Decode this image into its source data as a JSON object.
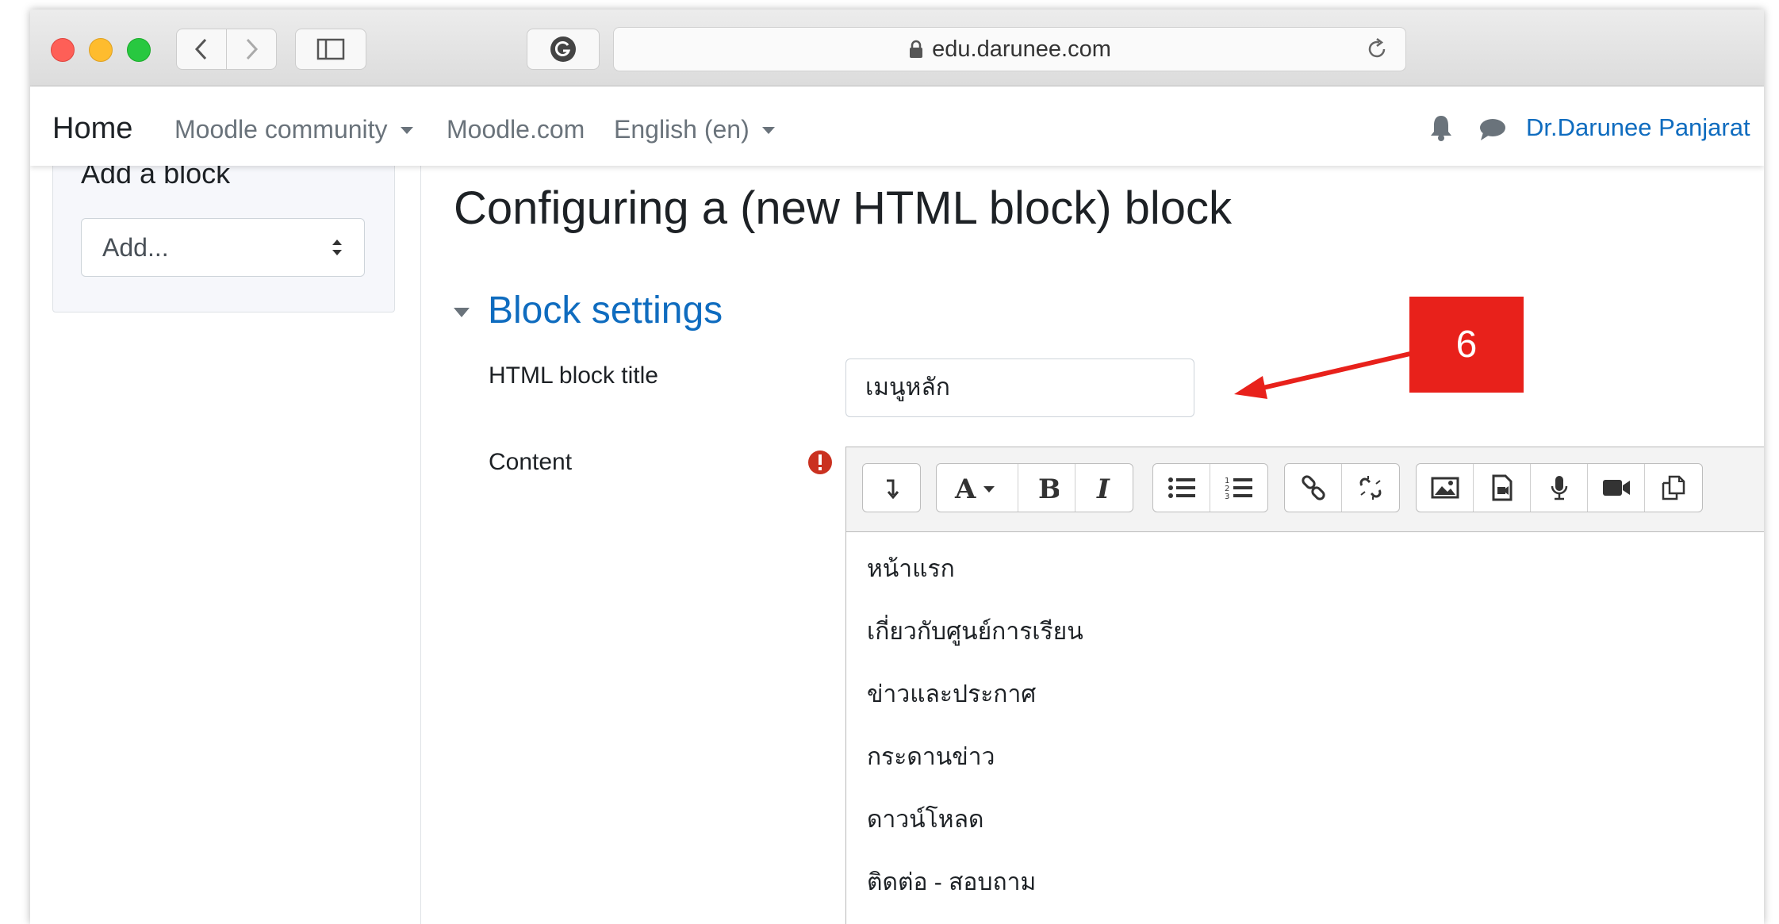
{
  "browser": {
    "url": "edu.darunee.com",
    "traffic_light_colors": [
      "#fe5f57",
      "#febc2e",
      "#28c840"
    ]
  },
  "navbar": {
    "home": "Home",
    "community": "Moodle community",
    "moodle_com": "Moodle.com",
    "language": "English (en)",
    "user": "Dr.Darunee Panjarat"
  },
  "sidebar": {
    "heading": "Add a block",
    "select_value": "Add..."
  },
  "main": {
    "page_title": "Configuring a (new HTML block) block",
    "section_title": "Block settings",
    "title_label": "HTML block title",
    "title_value": "เมนูหลัก",
    "content_label": "Content",
    "content_lines": [
      "หน้าแรก",
      "เกี่ยวกับศูนย์การเรียน",
      "ข่าวและประกาศ",
      "กระดานข่าว",
      "ดาวน์โหลด",
      "ติดต่อ - สอบถาม"
    ]
  },
  "callout": {
    "number": "6",
    "color": "#e8211b"
  },
  "colors": {
    "link_blue": "#0f6cbf",
    "required_red": "#ca3120"
  }
}
